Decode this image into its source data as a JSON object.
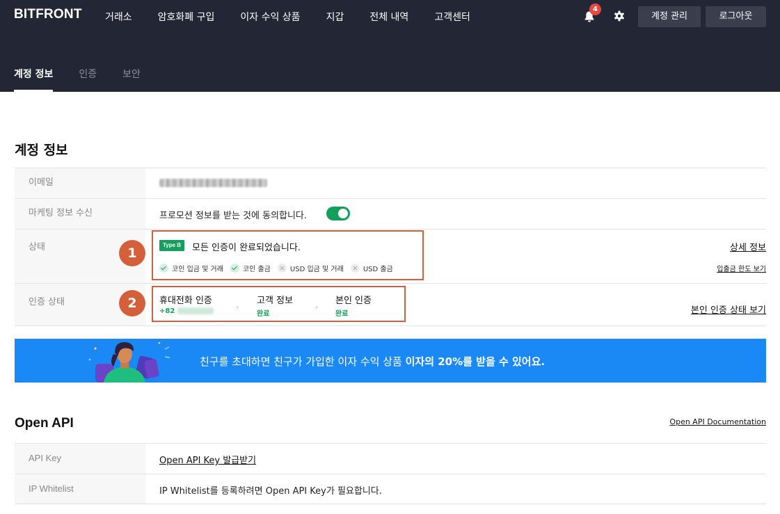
{
  "header": {
    "logo": "BITFRONT",
    "nav": [
      "거래소",
      "암호화폐 구입",
      "이자 수익 상품",
      "지갑",
      "전체 내역",
      "고객센터"
    ],
    "notification_count": "4",
    "account_button": "계정 관리",
    "logout_button": "로그아웃",
    "subtabs": [
      "계정 정보",
      "인증",
      "보안"
    ]
  },
  "account": {
    "title": "계정 정보",
    "email_label": "이메일",
    "marketing_label": "마케팅 정보 수신",
    "marketing_text": "프로모션 정보를 받는 것에 동의합니다.",
    "marketing_enabled": true,
    "status_label": "상태",
    "status_badge": "Type B",
    "status_text": "모든 인증이 완료되었습니다.",
    "status_items": [
      {
        "label": "코인 입금 및 거래",
        "done": true
      },
      {
        "label": "코인 출금",
        "done": true
      },
      {
        "label": "USD 입금 및 거래",
        "done": false
      },
      {
        "label": "USD 출금",
        "done": false
      }
    ],
    "detail_link": "상세 정보",
    "limit_link": "입출금 한도 보기",
    "verification_label": "인증 상태",
    "steps": [
      {
        "title": "휴대전화 인증",
        "sub": "+82"
      },
      {
        "title": "고객 정보",
        "sub": "완료"
      },
      {
        "title": "본인 인증",
        "sub": "완료"
      }
    ],
    "verification_link": "본인 인증 상태 보기",
    "markers": [
      "1",
      "2"
    ]
  },
  "banner": {
    "text_prefix": "친구를 초대하면 친구가 가입한 이자 수익 상품 ",
    "text_bold": "이자의 20%",
    "text_suffix": "를 받을 수 있어요."
  },
  "api": {
    "title": "Open API",
    "doc_link": "Open API Documentation",
    "key_label": "API Key",
    "key_link": "Open API Key 발급받기",
    "whitelist_label": "IP Whitelist",
    "whitelist_text": "IP Whitelist를 등록하려면 Open API Key가 필요합니다."
  },
  "colors": {
    "header_bg": "#232735",
    "accent_green": "#12a05c",
    "highlight": "#d35f3b",
    "banner_blue": "#1a89f5"
  }
}
